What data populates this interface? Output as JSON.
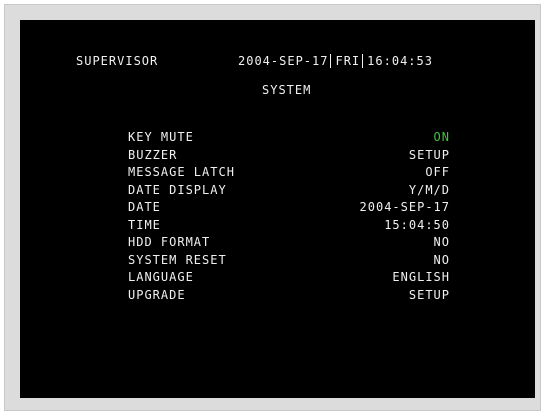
{
  "header": {
    "user": "SUPERVISOR",
    "date": "2004-SEP-17",
    "weekday": "FRI",
    "time": "16:04:53"
  },
  "title": "SYSTEM",
  "menu": [
    {
      "label": "KEY MUTE",
      "value": "ON"
    },
    {
      "label": "BUZZER",
      "value": "SETUP"
    },
    {
      "label": "MESSAGE LATCH",
      "value": "OFF"
    },
    {
      "label": "DATE DISPLAY",
      "value": "Y/M/D"
    },
    {
      "label": "DATE",
      "value": "2004-SEP-17"
    },
    {
      "label": "TIME",
      "value": "15:04:50"
    },
    {
      "label": "HDD FORMAT",
      "value": "NO"
    },
    {
      "label": "SYSTEM RESET",
      "value": "NO"
    },
    {
      "label": "LANGUAGE",
      "value": "ENGLISH"
    },
    {
      "label": "UPGRADE",
      "value": "SETUP"
    }
  ],
  "colors": {
    "screen_bg": "#000000",
    "text": "#f0f0f0",
    "active_value": "#3cc43c",
    "frame": "#dcdcdc"
  }
}
